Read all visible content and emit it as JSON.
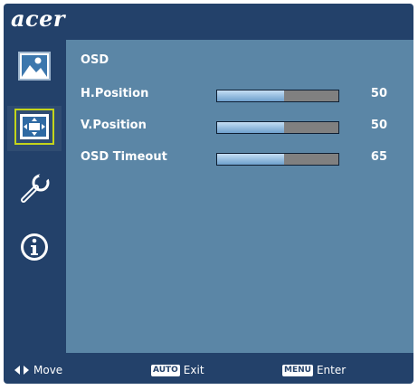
{
  "brand": {
    "logo_text": "acer"
  },
  "sidebar": {
    "tabs": [
      {
        "name": "picture",
        "icon": "picture-icon",
        "selected": false
      },
      {
        "name": "osd-position",
        "icon": "osd-position-icon",
        "selected": true
      },
      {
        "name": "setup",
        "icon": "wrench-icon",
        "selected": false
      },
      {
        "name": "information",
        "icon": "info-icon",
        "selected": false
      }
    ]
  },
  "panel": {
    "title": "OSD",
    "rows": [
      {
        "label": "H.Position",
        "value": "50",
        "level": 0.55
      },
      {
        "label": "V.Position",
        "value": "50",
        "level": 0.55
      },
      {
        "label": "OSD Timeout",
        "value": "65",
        "level": 0.55
      }
    ]
  },
  "footer": {
    "move_label": "Move",
    "auto_key": "AUTO",
    "exit_label": "Exit",
    "menu_key": "MENU",
    "enter_label": "Enter"
  },
  "colors": {
    "frame": "#23416a",
    "panel": "#5b86a6",
    "slider_track": "#808080",
    "slider_fill": "#9cc2e2",
    "selection_border": "#c4d51a"
  }
}
